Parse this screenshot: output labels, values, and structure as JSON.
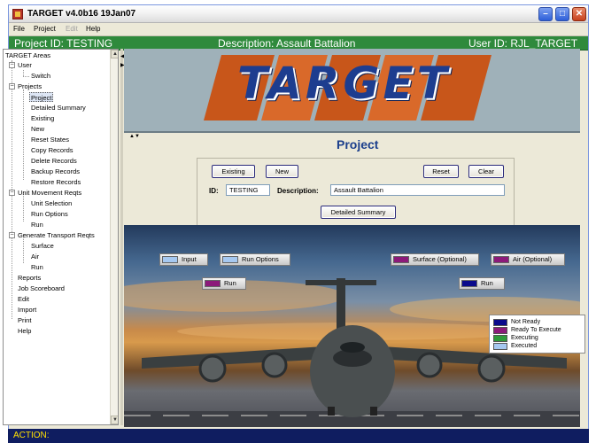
{
  "window": {
    "title": "TARGET  v4.0b16  19Jan07",
    "controls": {
      "minimize": "–",
      "maximize": "□",
      "close": "✕"
    }
  },
  "menu": {
    "file": "File",
    "project": "Project",
    "edit": "Edit",
    "help": "Help"
  },
  "infobar": {
    "project": "Project ID: TESTING",
    "description": "Description: Assault Battalion",
    "user": "User ID: RJL_TARGET"
  },
  "tree": {
    "root": "TARGET Areas",
    "user": "User",
    "user_switch": "Switch",
    "projects": "Projects",
    "project": "Project",
    "detailed_summary": "Detailed Summary",
    "existing": "Existing",
    "new": "New",
    "reset_states": "Reset States",
    "copy_records": "Copy Records",
    "delete_records": "Delete Records",
    "backup_records": "Backup Records",
    "restore_records": "Restore Records",
    "unit_movement": "Unit Movement Reqts",
    "unit_selection": "Unit Selection",
    "run_options": "Run Options",
    "run": "Run",
    "generate_transport": "Generate Transport Reqts",
    "surface": "Surface",
    "air": "Air",
    "run2": "Run",
    "reports": "Reports",
    "job_scoreboard": "Job Scoreboard",
    "edit": "Edit",
    "import": "Import",
    "print": "Print",
    "help": "Help",
    "expander_minus": "−",
    "scroll_up": "▲",
    "scroll_down": "▼"
  },
  "banner": {
    "logo_text": "TARGET"
  },
  "main": {
    "title": "Project",
    "buttons": {
      "existing": "Existing",
      "new": "New",
      "reset": "Reset",
      "clear": "Clear",
      "detailed_summary": "Detailed Summary"
    },
    "id_label": "ID:",
    "id_value": "TESTING",
    "description_label": "Description:",
    "description_value": "Assault Battalion"
  },
  "workflow": {
    "input": "Input",
    "run_options": "Run Options",
    "run_left": "Run",
    "surface": "Surface (Optional)",
    "air": "Air (Optional)",
    "run_right": "Run"
  },
  "legend": {
    "items": [
      {
        "label": "Not Ready",
        "color": "#0a0a8c"
      },
      {
        "label": "Ready To Execute",
        "color": "#8c1a7a"
      },
      {
        "label": "Executing",
        "color": "#2e9b3a"
      },
      {
        "label": "Executed",
        "color": "#a6c8f0"
      }
    ]
  },
  "colors": {
    "executed": "#a6c8f0",
    "ready": "#8c1a7a",
    "not_ready": "#0a0a8c",
    "executing": "#2e9b3a",
    "infobar": "#2f8a3c",
    "statusbar": "#0f1d60",
    "status_text": "#ffe000"
  },
  "status": {
    "text": "ACTION:"
  }
}
